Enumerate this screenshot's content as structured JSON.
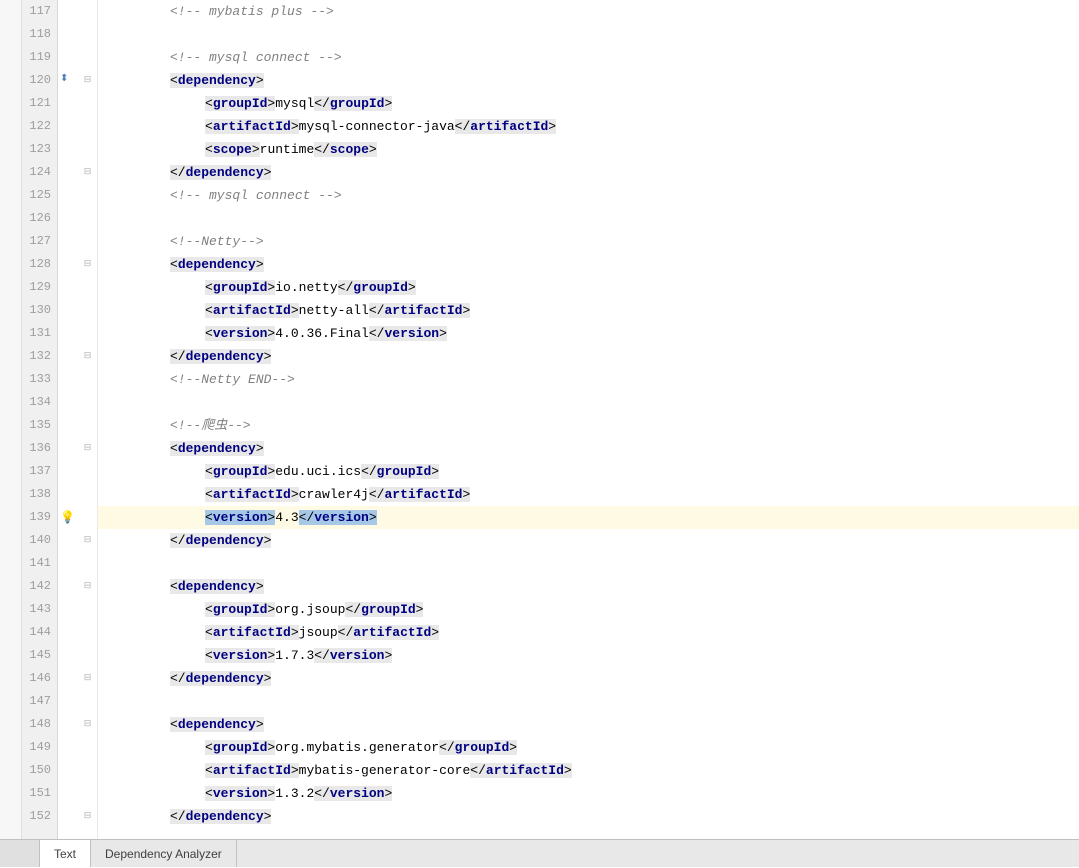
{
  "lines": {
    "start": 117,
    "end": 152,
    "current": 139,
    "foldMarks": {
      "120": "open",
      "124": "close",
      "128": "open",
      "132": "close",
      "136": "open",
      "140": "close",
      "142": "open",
      "146": "close",
      "148": "open",
      "152": "close"
    },
    "iconMarks": {
      "120": "arrow",
      "139": "bulb"
    }
  },
  "comments": {
    "c117": "<!-- mybatis plus -->",
    "c119": "<!-- mysql connect -->",
    "c125": "<!-- mysql connect -->",
    "c127": "<!--Netty-->",
    "c133": "<!--Netty END-->",
    "c135": "<!--爬虫-->"
  },
  "tags": {
    "dependency": "dependency",
    "groupId": "groupId",
    "artifactId": "artifactId",
    "scope": "scope",
    "version": "version"
  },
  "text": {
    "t121": "mysql",
    "t122": "mysql-connector-java",
    "t123": "runtime",
    "t129": "io.netty",
    "t130": "netty-all",
    "t131": "4.0.36.Final",
    "t137": "edu.uci.ics",
    "t138": "crawler4j",
    "t139": "4.3",
    "t143": "org.jsoup",
    "t144": "jsoup",
    "t145": "1.7.3",
    "t149": "org.mybatis.generator",
    "t150": "mybatis-generator-core",
    "t151": "1.3.2"
  },
  "tabs": {
    "text": "Text",
    "analyzer": "Dependency Analyzer"
  }
}
